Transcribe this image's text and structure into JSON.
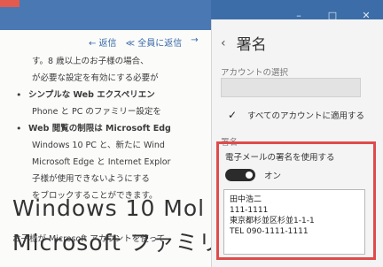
{
  "window": {
    "controls": {
      "minimize": "–",
      "maximize": "□",
      "close": "✕"
    }
  },
  "reader": {
    "toolbar": {
      "reply": "← 返信",
      "reply_all": "≪ 全員に返信",
      "forward": "→"
    },
    "lines": [
      "す。8 歳以上のお子様の場合、",
      "が必要な設定を有効にする必要が"
    ],
    "bullet1": {
      "title": "シンプルな Web エクスペリエン",
      "line2": "Phone と PC のファミリー設定を"
    },
    "bullet2": {
      "title": "Web 閲覧の制限は Microsoft Edg",
      "lines": [
        "Windows 10 PC と、新たに Wind",
        "Microsoft Edge と Internet Explor",
        "子様が使用できないようにする",
        "をブロックすることができます。"
      ]
    },
    "heading1": "Windows 10 Mol",
    "heading2": "Microsoft ファミリ",
    "footer": "お子様が Microsoft アカウントを使って"
  },
  "settings": {
    "title": "署名",
    "account_select_label": "アカウントの選択",
    "apply_all_label": "すべてのアカウントに適用する",
    "apply_all_checked": true,
    "signature_section_label": "署名",
    "use_signature_label": "電子メールの署名を使用する",
    "toggle_state": "オン",
    "signature_lines": [
      "田中浩二",
      "111-1111",
      "東京都杉並区杉並1-1-1",
      "TEL 090-1111-1111"
    ]
  },
  "colors": {
    "titlebar": "#3d6da8",
    "highlight_border": "#e04b4b",
    "toggle_on": "#2b2b2b"
  }
}
